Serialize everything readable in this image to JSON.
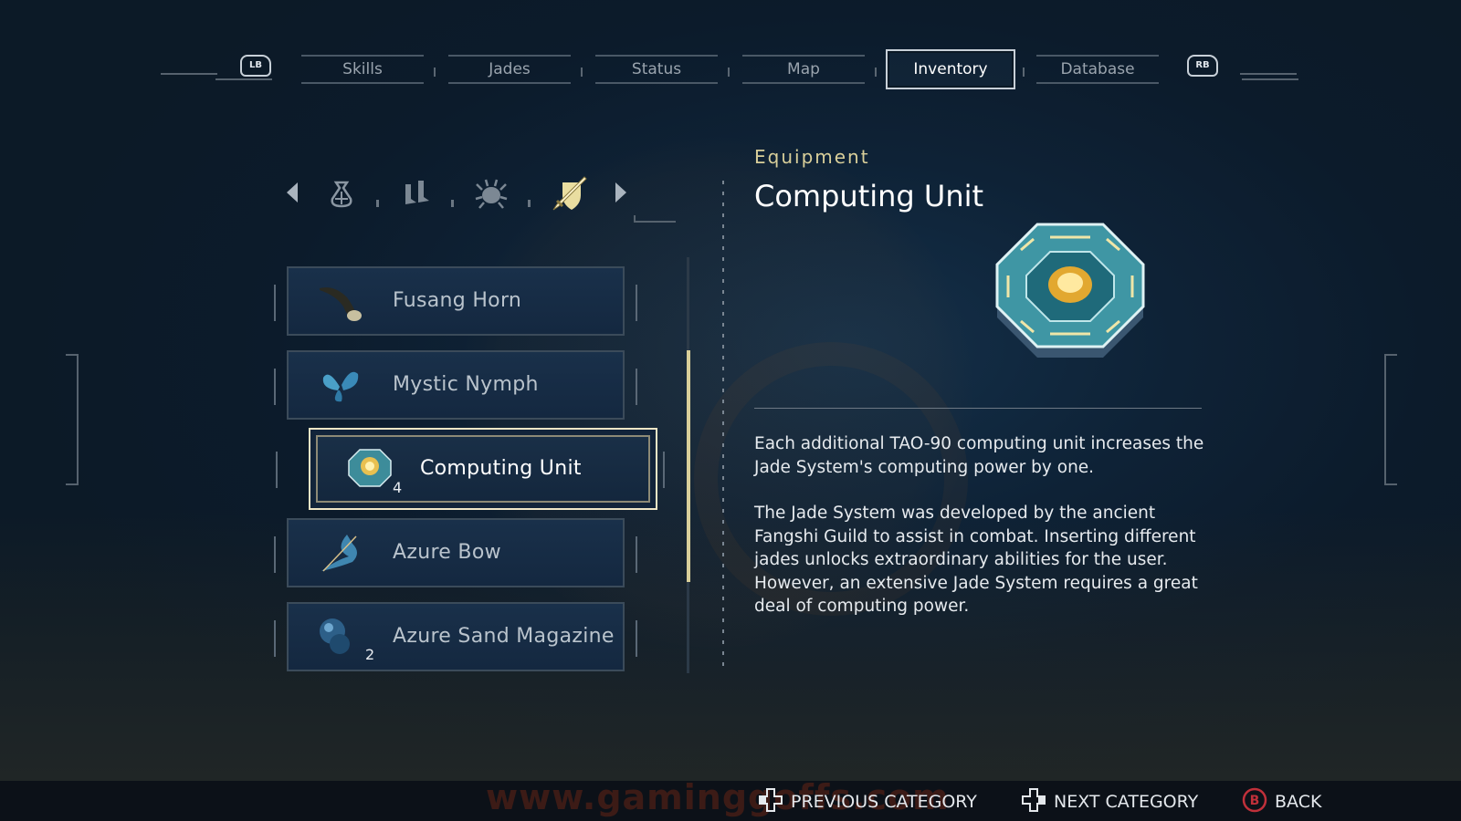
{
  "tabs": {
    "left_bumper": "LB",
    "right_bumper": "RB",
    "items": [
      {
        "label": "Skills"
      },
      {
        "label": "Jades"
      },
      {
        "label": "Status"
      },
      {
        "label": "Map"
      },
      {
        "label": "Inventory",
        "active": true
      },
      {
        "label": "Database"
      }
    ]
  },
  "categories": {
    "icons": [
      "pouch-icon",
      "boots-icon",
      "bug-icon",
      "sword-shield-icon"
    ],
    "selected_index": 3
  },
  "items": [
    {
      "name": "Fusang Horn",
      "icon": "horn-icon",
      "count": ""
    },
    {
      "name": "Mystic Nymph",
      "icon": "butterfly-icon",
      "count": ""
    },
    {
      "name": "Computing Unit",
      "icon": "computing-unit-icon",
      "count": "4",
      "selected": true
    },
    {
      "name": "Azure Bow",
      "icon": "bow-icon",
      "count": ""
    },
    {
      "name": "Azure Sand Magazine",
      "icon": "magazine-icon",
      "count": "2"
    }
  ],
  "scroll": {
    "position": 0.45
  },
  "detail": {
    "category": "Equipment",
    "title": "Computing Unit",
    "description_1": "Each additional TAO-90 computing unit increases the Jade System's computing power by one.",
    "description_2": "The Jade System was developed by the ancient Fangshi Guild to assist in combat. Inserting different jades unlocks extraordinary abilities for the user. However, an extensive Jade System requires a great deal of computing power."
  },
  "footer": {
    "watermark": "www.gaminggoffs.com",
    "prev_category": "PREVIOUS CATEGORY",
    "next_category": "NEXT CATEGORY",
    "back": "BACK",
    "back_button_glyph": "B"
  },
  "colors": {
    "accent_gold": "#d9cf9a",
    "panel_bg": "#142840",
    "back_button_red": "#c0303a"
  }
}
